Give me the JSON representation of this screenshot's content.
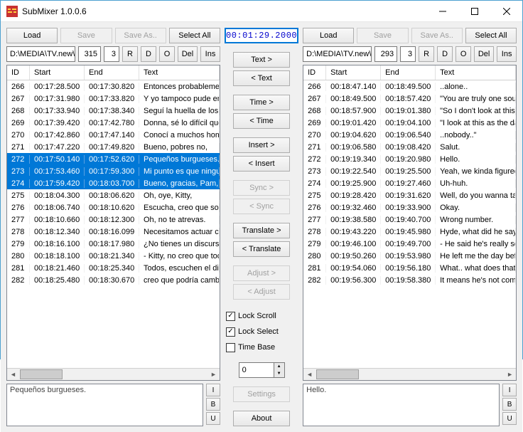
{
  "app": {
    "title": "SubMixer 1.0.0.6"
  },
  "timer": "00:01:29.2000",
  "toolbar": {
    "load": "Load",
    "save": "Save",
    "saveas": "Save As..",
    "selectall": "Select All",
    "R": "R",
    "D": "D",
    "O": "O",
    "del": "Del",
    "ins": "Ins"
  },
  "left": {
    "path": "D:\\MEDIA\\TV.new\\That 7",
    "num1": "315",
    "num2": "3"
  },
  "right": {
    "path": "D:\\MEDIA\\TV.new\\That",
    "num1": "293",
    "num2": "3"
  },
  "cols": {
    "id": "ID",
    "start": "Start",
    "end": "End",
    "text": "Text"
  },
  "center": {
    "textf": "Text >",
    "textb": "< Text",
    "timef": "Time >",
    "timeb": "< Time",
    "insf": "Insert >",
    "insb": "< Insert",
    "syncf": "Sync >",
    "syncb": "< Sync",
    "transf": "Translate >",
    "transb": "< Translate",
    "adjf": "Adjust >",
    "adjb": "< Adjust",
    "lockscroll": "Lock Scroll",
    "lockselect": "Lock Select",
    "timebase": "Time Base",
    "spinner": "0",
    "settings": "Settings",
    "about": "About"
  },
  "fmt": {
    "I": "I",
    "B": "B",
    "U": "U"
  },
  "leftPreview": "Pequeños burgueses.",
  "rightPreview": "Hello.",
  "leftRows": [
    {
      "id": "266",
      "s": "00:17:28.500",
      "e": "00:17:30.820",
      "t": "Entonces probablemente"
    },
    {
      "id": "267",
      "s": "00:17:31.980",
      "e": "00:17:33.820",
      "t": "Y yo tampoco pude enco"
    },
    {
      "id": "268",
      "s": "00:17:33.940",
      "e": "00:17:38.340",
      "t": "Seguí la huella de los pa"
    },
    {
      "id": "269",
      "s": "00:17:39.420",
      "e": "00:17:42.780",
      "t": "Donna, sé lo difícil que e"
    },
    {
      "id": "270",
      "s": "00:17:42.860",
      "e": "00:17:47.140",
      "t": "Conocí a muchos hombr"
    },
    {
      "id": "271",
      "s": "00:17:47.220",
      "e": "00:17:49.820",
      "t": "Bueno, pobres no,"
    },
    {
      "id": "272",
      "s": "00:17:50.140",
      "e": "00:17:52.620",
      "t": "Pequeños burgueses.",
      "sel": true
    },
    {
      "id": "273",
      "s": "00:17:53.460",
      "e": "00:17:59.300",
      "t": "Mi punto es que ninguno",
      "sel": true
    },
    {
      "id": "274",
      "s": "00:17:59.420",
      "e": "00:18:03.700",
      "t": "Bueno, gracias, Pam, pe",
      "sel": true
    },
    {
      "id": "275",
      "s": "00:18:04.300",
      "e": "00:18:06.620",
      "t": "Oh, oye, Kitty,"
    },
    {
      "id": "276",
      "s": "00:18:06.740",
      "e": "00:18:10.620",
      "t": "Escucha, creo que solo"
    },
    {
      "id": "277",
      "s": "00:18:10.660",
      "e": "00:18:12.300",
      "t": "Oh, no te atrevas."
    },
    {
      "id": "278",
      "s": "00:18:12.340",
      "e": "00:18:16.099",
      "t": "Necesitamos actuar com"
    },
    {
      "id": "279",
      "s": "00:18:16.100",
      "e": "00:18:17.980",
      "t": "¿No tienes un discurso p"
    },
    {
      "id": "280",
      "s": "00:18:18.100",
      "e": "00:18:21.340",
      "t": "- Kitty, no creo que todav"
    },
    {
      "id": "281",
      "s": "00:18:21.460",
      "e": "00:18:25.340",
      "t": "Todos, escuchen el disc"
    },
    {
      "id": "282",
      "s": "00:18:25.480",
      "e": "00:18:30.670",
      "t": "creo que podría cambiar"
    }
  ],
  "rightRows": [
    {
      "id": "266",
      "s": "00:18:47.140",
      "e": "00:18:49.500",
      "t": "..alone.."
    },
    {
      "id": "267",
      "s": "00:18:49.500",
      "e": "00:18:57.420",
      "t": "\"You are truly one soul"
    },
    {
      "id": "268",
      "s": "00:18:57.900",
      "e": "00:19:01.380",
      "t": "\"So I don't look at this"
    },
    {
      "id": "269",
      "s": "00:19:01.420",
      "e": "00:19:04.100",
      "t": "\"I look at this as the da"
    },
    {
      "id": "270",
      "s": "00:19:04.620",
      "e": "00:19:06.540",
      "t": "..nobody..\""
    },
    {
      "id": "271",
      "s": "00:19:06.580",
      "e": "00:19:08.420",
      "t": "Salut."
    },
    {
      "id": "272",
      "s": "00:19:19.340",
      "e": "00:19:20.980",
      "t": "Hello."
    },
    {
      "id": "273",
      "s": "00:19:22.540",
      "e": "00:19:25.500",
      "t": "Yeah, we kinda figured"
    },
    {
      "id": "274",
      "s": "00:19:25.900",
      "e": "00:19:27.460",
      "t": "Uh-huh."
    },
    {
      "id": "275",
      "s": "00:19:28.420",
      "e": "00:19:31.620",
      "t": "Well, do you wanna ta"
    },
    {
      "id": "276",
      "s": "00:19:32.460",
      "e": "00:19:33.900",
      "t": "Okay."
    },
    {
      "id": "277",
      "s": "00:19:38.580",
      "e": "00:19:40.700",
      "t": "Wrong number."
    },
    {
      "id": "278",
      "s": "00:19:43.220",
      "e": "00:19:45.980",
      "t": "Hyde, what did he say"
    },
    {
      "id": "279",
      "s": "00:19:46.100",
      "e": "00:19:49.700",
      "t": "- He said he's really sor"
    },
    {
      "id": "280",
      "s": "00:19:50.260",
      "e": "00:19:53.980",
      "t": "He left me the day befo"
    },
    {
      "id": "281",
      "s": "00:19:54.060",
      "e": "00:19:56.180",
      "t": "What.. what does that"
    },
    {
      "id": "282",
      "s": "00:19:56.300",
      "e": "00:19:58.380",
      "t": "It means he's not comi"
    }
  ]
}
